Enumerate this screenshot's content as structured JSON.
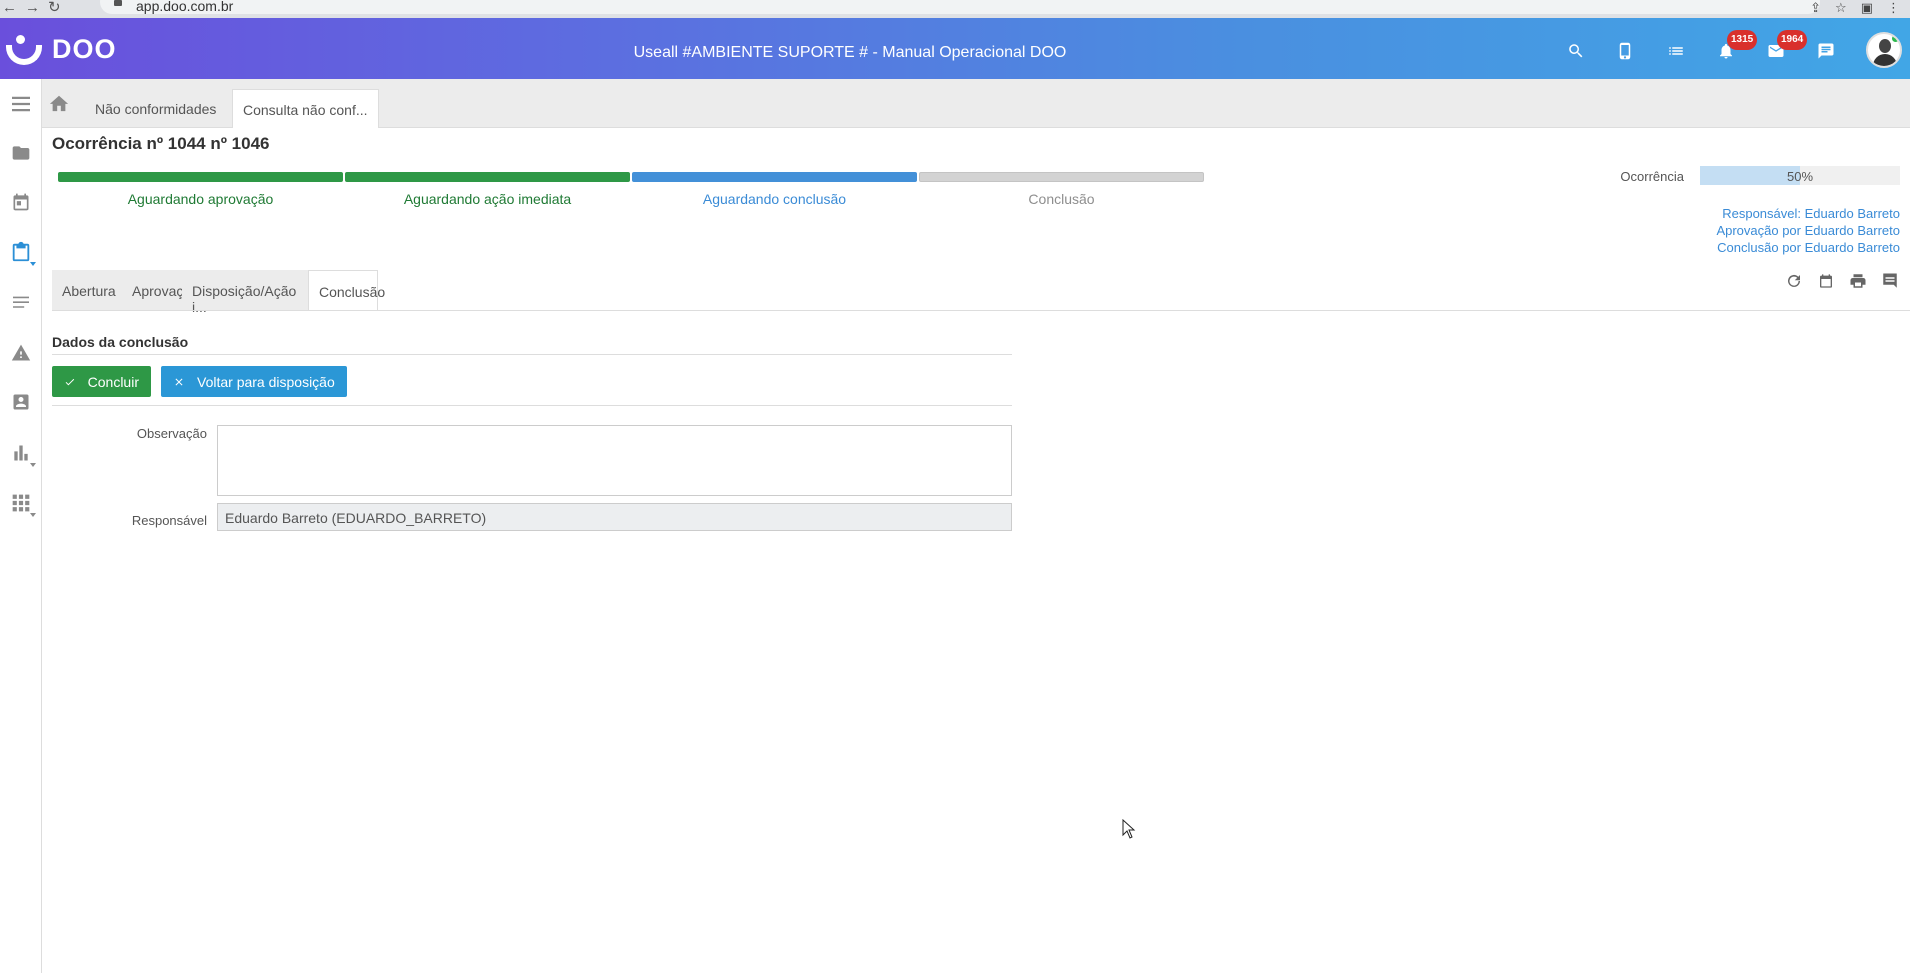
{
  "browser": {
    "url": "app.doo.com.br"
  },
  "header": {
    "brand": "DOO",
    "title": "Useall #AMBIENTE SUPORTE # - Manual Operacional DOO",
    "notifications_count": "1315",
    "messages_count": "1964"
  },
  "sidebar": {
    "items": [
      {
        "name": "menu-icon"
      },
      {
        "name": "folder-icon"
      },
      {
        "name": "calendar-icon"
      },
      {
        "name": "clipboard-icon",
        "active": true
      },
      {
        "name": "list-icon"
      },
      {
        "name": "warning-icon"
      },
      {
        "name": "contact-icon"
      },
      {
        "name": "bar-chart-icon"
      },
      {
        "name": "apps-grid-icon"
      }
    ]
  },
  "tabs": {
    "items": [
      {
        "label": "Não conformidades"
      },
      {
        "label": "Consulta não conf..."
      }
    ]
  },
  "occurrence": {
    "title": "Ocorrência nº 1044 nº 1046",
    "steps": [
      {
        "label": "Aguardando aprovação",
        "state": "done"
      },
      {
        "label": "Aguardando ação imediata",
        "state": "done"
      },
      {
        "label": "Aguardando conclusão",
        "state": "current"
      },
      {
        "label": "Conclusão",
        "state": "pending"
      }
    ],
    "progress_label": "Ocorrência",
    "progress_value": 0.5,
    "progress_text": "50%",
    "responsible": "Responsável: Eduardo Barreto",
    "approval_by": "Aprovação por Eduardo Barreto",
    "conclusion_by": "Conclusão por Eduardo Barreto"
  },
  "subtabs": {
    "items": [
      {
        "label": "Abertura"
      },
      {
        "label": "Aprovação"
      },
      {
        "label": "Disposição/Ação i..."
      },
      {
        "label": "Conclusão"
      }
    ]
  },
  "form": {
    "section_title": "Dados da conclusão",
    "conclude_label": "Concluir",
    "back_label": "Voltar para disposição",
    "observation_label": "Observação",
    "observation_value": "",
    "responsible_label": "Responsável",
    "responsible_value": "Eduardo Barreto  (EDUARDO_BARRETO)"
  },
  "colors": {
    "header_start": "#6a4fdc",
    "header_end": "#41a6e6",
    "done": "#2e9846",
    "current": "#4390d8",
    "pending": "#d3d3d3",
    "badge": "#d9302c"
  }
}
